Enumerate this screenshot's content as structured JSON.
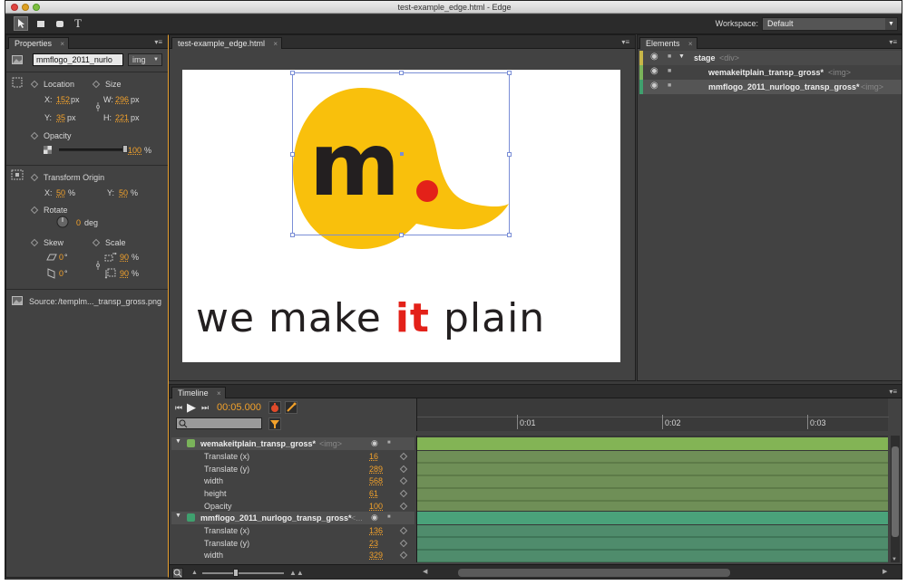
{
  "window": {
    "title": "test-example_edge.html - Edge"
  },
  "toolbar": {
    "tools": [
      "selection-tool",
      "rectangle-tool",
      "rounded-rectangle-tool",
      "text-tool"
    ],
    "text_tool_glyph": "T",
    "workspace_label": "Workspace:",
    "workspace_value": "Default"
  },
  "properties": {
    "tab": "Properties",
    "element_name": "mmflogo_2011_nurlo",
    "element_type": "img",
    "location_label": "Location",
    "size_label": "Size",
    "x_label": "X:",
    "x_value": "152",
    "x_unit": "px",
    "y_label": "Y:",
    "y_value": "35",
    "y_unit": "px",
    "w_label": "W:",
    "w_value": "296",
    "w_unit": "px",
    "h_label": "H:",
    "h_value": "221",
    "h_unit": "px",
    "opacity_label": "Opacity",
    "opacity_value": "100",
    "opacity_unit": "%",
    "opacity_level": 1.0,
    "transform_origin_label": "Transform Origin",
    "tox_label": "X:",
    "tox_value": "50",
    "tox_unit": "%",
    "toy_label": "Y:",
    "toy_value": "50",
    "toy_unit": "%",
    "rotate_label": "Rotate",
    "rotate_value": "0",
    "rotate_unit": "deg",
    "skew_label": "Skew",
    "scale_label": "Scale",
    "skew_x": "0",
    "skew_y": "0",
    "deg_sign": "°",
    "scale_x": "90",
    "scale_y": "90",
    "scale_unit": "%",
    "source_label": "Source:",
    "source_value": "/templm..._transp_gross.png"
  },
  "document": {
    "tab": "test-example_edge.html",
    "logo_letter": "m",
    "tagline_pre": "we make ",
    "tagline_it": "it",
    "tagline_post": " plain",
    "colors": {
      "bubble": "#f9c00c",
      "accent": "#e32119",
      "dark": "#231f20"
    }
  },
  "elements": {
    "tab": "Elements",
    "items": [
      {
        "name": "stage",
        "tag": "<div>"
      },
      {
        "name": "wemakeitplain_transp_gross*",
        "tag": "<img>"
      },
      {
        "name": "mmflogo_2011_nurlogo_transp_gross*",
        "tag": "<img>"
      }
    ]
  },
  "timeline": {
    "tab": "Timeline",
    "time": "00:05.000",
    "ruler": [
      "0:01",
      "0:02",
      "0:03"
    ],
    "layers": [
      {
        "name": "wemakeitplain_transp_gross*",
        "tag": "<img>",
        "props": [
          {
            "label": "Translate (x)",
            "value": "16"
          },
          {
            "label": "Translate (y)",
            "value": "289"
          },
          {
            "label": "width",
            "value": "568"
          },
          {
            "label": "height",
            "value": "61"
          },
          {
            "label": "Opacity",
            "value": "100"
          }
        ]
      },
      {
        "name": "mmflogo_2011_nurlogo_transp_gross*",
        "tag": "<...",
        "props": [
          {
            "label": "Translate (x)",
            "value": "136"
          },
          {
            "label": "Translate (y)",
            "value": "23"
          },
          {
            "label": "width",
            "value": "329"
          }
        ]
      }
    ]
  }
}
